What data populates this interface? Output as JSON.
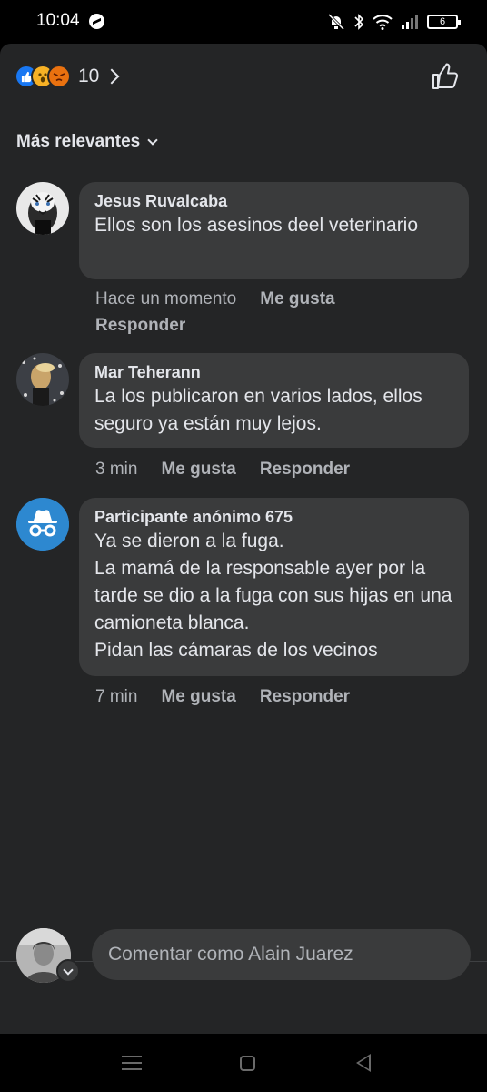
{
  "status_bar": {
    "time": "10:04",
    "battery": "6"
  },
  "reactions": {
    "count": "10",
    "types": [
      "like",
      "wow",
      "angry"
    ]
  },
  "sort": {
    "label": "Más relevantes"
  },
  "comments": [
    {
      "author": "Jesus Ruvalcaba",
      "text": "Ellos son los asesinos deel veterinario",
      "time": "Hace un momento",
      "like_label": "Me gusta",
      "reply_label": "Responder"
    },
    {
      "author": "Mar Teherann",
      "text": "La los publicaron en varios lados, ellos seguro ya están muy lejos.",
      "time": "3 min",
      "like_label": "Me gusta",
      "reply_label": "Responder"
    },
    {
      "author": "Participante anónimo 675",
      "text_lines": [
        "Ya se dieron a la fuga.",
        "La mamá de la responsable ayer por la tarde se dio a la fuga con sus hijas en una camioneta blanca.",
        "Pidan las cámaras de los vecinos"
      ],
      "time": "7 min",
      "like_label": "Me gusta",
      "reply_label": "Responder"
    }
  ],
  "composer": {
    "placeholder": "Comentar como Alain Juarez"
  },
  "colors": {
    "sheet_bg": "#242526",
    "bubble_bg": "#3a3b3c",
    "primary_text": "#e4e6eb",
    "secondary_text": "#b0b3b8",
    "like_blue": "#1877f2",
    "anon_avatar": "#2d88d0"
  }
}
